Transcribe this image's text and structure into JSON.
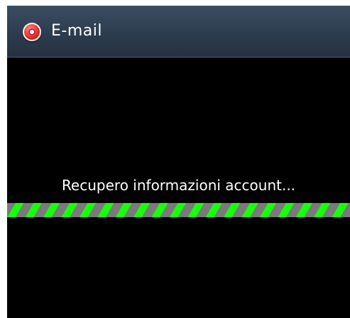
{
  "window": {
    "title": "E-mail",
    "icon": "email-app-icon"
  },
  "main": {
    "status_text": "Recupero informazioni account...",
    "progress": {
      "indeterminate": true,
      "fill_fraction": 1.0,
      "accent_color": "#35ff2a",
      "track_color": "#5f5f5f"
    }
  },
  "colors": {
    "titlebar": "#2b3b4d",
    "background": "#000000",
    "text": "#ffffff"
  }
}
